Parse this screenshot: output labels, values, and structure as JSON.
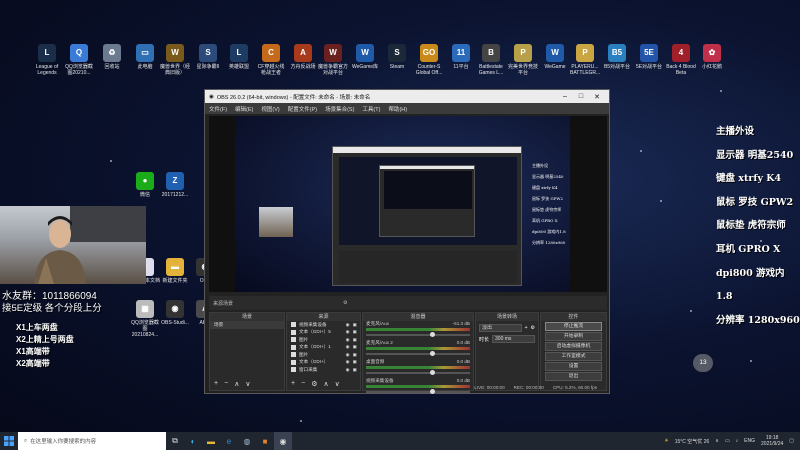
{
  "desktop_icons": [
    {
      "label": "League of Legends",
      "icon": "lol-icon",
      "color": "#1a2e4a",
      "glyph": "L"
    },
    {
      "label": "QQ浏览器截图20210...",
      "icon": "qq-browser-icon",
      "color": "#3a7bd5",
      "glyph": "Q"
    },
    {
      "label": "回收站",
      "icon": "recycle-bin-icon",
      "color": "#6b7a8f",
      "glyph": "♻"
    },
    {
      "label": "此电脑",
      "icon": "computer-icon",
      "color": "#2f6fb3",
      "glyph": "▭"
    },
    {
      "label": "魔兽世界（经典旧版）",
      "icon": "wow-classic-icon",
      "color": "#7a5a1a",
      "glyph": "W"
    },
    {
      "label": "星际争霸II",
      "icon": "starcraft-icon",
      "color": "#2c4a7a",
      "glyph": "S"
    },
    {
      "label": "英雄联盟",
      "icon": "lol-client-icon",
      "color": "#1d3b63",
      "glyph": "L"
    },
    {
      "label": "CF穿越火线枪战王者",
      "icon": "cf-icon",
      "color": "#c46a1a",
      "glyph": "C"
    },
    {
      "label": "方舟反战场",
      "icon": "ark-icon",
      "color": "#a63a1a",
      "glyph": "A"
    },
    {
      "label": "魔兽争霸官方对战平台",
      "icon": "warcraft-icon",
      "color": "#6b2020",
      "glyph": "W"
    },
    {
      "label": "WeGame库",
      "icon": "wegame-icon",
      "color": "#1f5aa8",
      "glyph": "W"
    },
    {
      "label": "Steam",
      "icon": "steam-icon",
      "color": "#1b2838",
      "glyph": "S"
    },
    {
      "label": "Counter-S Global Off...",
      "icon": "csgo-icon",
      "color": "#c98a1a",
      "glyph": "GO"
    },
    {
      "label": "11平台",
      "icon": "platform11-icon",
      "color": "#2a6ab8",
      "glyph": "11"
    },
    {
      "label": "Battlestate Games L...",
      "icon": "battlestate-icon",
      "color": "#444",
      "glyph": "B"
    },
    {
      "label": "完美世界竞技平台",
      "icon": "perfect-world-icon",
      "color": "#b8a04a",
      "glyph": "P"
    },
    {
      "label": "WeGame",
      "icon": "wegame2-icon",
      "color": "#1f5aa8",
      "glyph": "W"
    },
    {
      "label": "PLAYERU... BATTLEGR...",
      "icon": "pubg-icon",
      "color": "#c9a642",
      "glyph": "P"
    },
    {
      "label": "B5对战平台",
      "icon": "b5-icon",
      "color": "#2a7fbf",
      "glyph": "B5"
    },
    {
      "label": "5E对战平台",
      "icon": "5e-icon",
      "color": "#2255aa",
      "glyph": "5E"
    },
    {
      "label": "Back 4 Blood Beta",
      "icon": "b4b-icon",
      "color": "#a0202a",
      "glyph": "4"
    },
    {
      "label": "小红花鹅",
      "icon": "goose-icon",
      "color": "#c0304a",
      "glyph": "✿"
    }
  ],
  "desktop_icons_2": [
    {
      "label": "微信",
      "icon": "wechat-icon",
      "color": "#1aad19",
      "glyph": "●"
    },
    {
      "label": "20171212...",
      "icon": "zip-icon",
      "color": "#2060b0",
      "glyph": "Z"
    },
    {
      "label": "QQ浏览器截图20210824...",
      "icon": "qq-shot-icon",
      "color": "#bbb",
      "glyph": "▦"
    },
    {
      "label": "OBS-Studi...",
      "icon": "obs-icon",
      "color": "#333",
      "glyph": "◉"
    },
    {
      "label": "AH...",
      "icon": "ah-icon",
      "color": "#4a4a4a",
      "glyph": "A"
    },
    {
      "label": "新建文件夹",
      "icon": "folder-icon",
      "color": "#e2b23a",
      "glyph": "▬"
    },
    {
      "label": "新建文本文档",
      "icon": "textfile-icon",
      "color": "#dde",
      "glyph": "≡"
    },
    {
      "label": "OBS",
      "icon": "obs2-icon",
      "color": "#333",
      "glyph": "◉"
    }
  ],
  "obs": {
    "title": "OBS 26.0.2 (64-bit, windows) - 配置文件: 未命名 - 场景: 未命名",
    "menu": [
      "文件(F)",
      "编辑(E)",
      "视图(V)",
      "配置文件(P)",
      "场景集合(S)",
      "工具(T)",
      "帮助(H)"
    ],
    "scene_tab_label": "来源场景",
    "docks": {
      "scenes": {
        "title": "场景",
        "items": [
          "场景"
        ]
      },
      "sources": {
        "title": "来源",
        "items": [
          "视频采集设备",
          "文本（GDI+）5",
          "图片",
          "文本（GDI+）1",
          "图片",
          "文本（GDI+）",
          "窗口采集"
        ]
      },
      "mixer": {
        "title": "混音器",
        "tracks": [
          {
            "name": "麦克风/Aux",
            "db": "-51.3 dB"
          },
          {
            "name": "麦克风/Aux 2",
            "db": "0.0 dB"
          },
          {
            "name": "桌面音频",
            "db": "0.0 dB"
          },
          {
            "name": "视频采集设备",
            "db": "0.0 dB"
          }
        ]
      },
      "transitions": {
        "title": "场景转场",
        "type": "淡出",
        "duration_label": "时长",
        "duration": "300 ms"
      },
      "controls": {
        "title": "控件",
        "buttons": [
          "停止推流",
          "开始录制",
          "启动虚拟摄像机",
          "工作室模式",
          "设置",
          "退出"
        ]
      }
    },
    "status": {
      "live": "LIVE: 00:00:00",
      "rec": "REC: 00:00:00",
      "cpu": "CPU: 5.2%, 60.00 fps"
    }
  },
  "overlay": {
    "qq_group": "水友群：1011866094",
    "banner": "接5E定级  各个分段上分",
    "list": [
      "X1上车两盘",
      "X2上精上号两盘",
      "X1高端带",
      "X2高端带"
    ]
  },
  "specs": [
    "主播外设",
    "显示器 明基2540",
    "键盘 xtrfy K4",
    "鼠标 罗技 GPW2",
    "鼠标垫 虎符宗师",
    "耳机 GPRO X",
    "dpi800 游戏内1.8",
    "分辨率 1280x960"
  ],
  "viewer_badge": "13",
  "taskbar": {
    "search_placeholder": "在这里输入你要搜索的内容",
    "weather": "15°C 空气优 26",
    "lang": "ENG",
    "time": "19:18",
    "date": "2021/9/24"
  }
}
